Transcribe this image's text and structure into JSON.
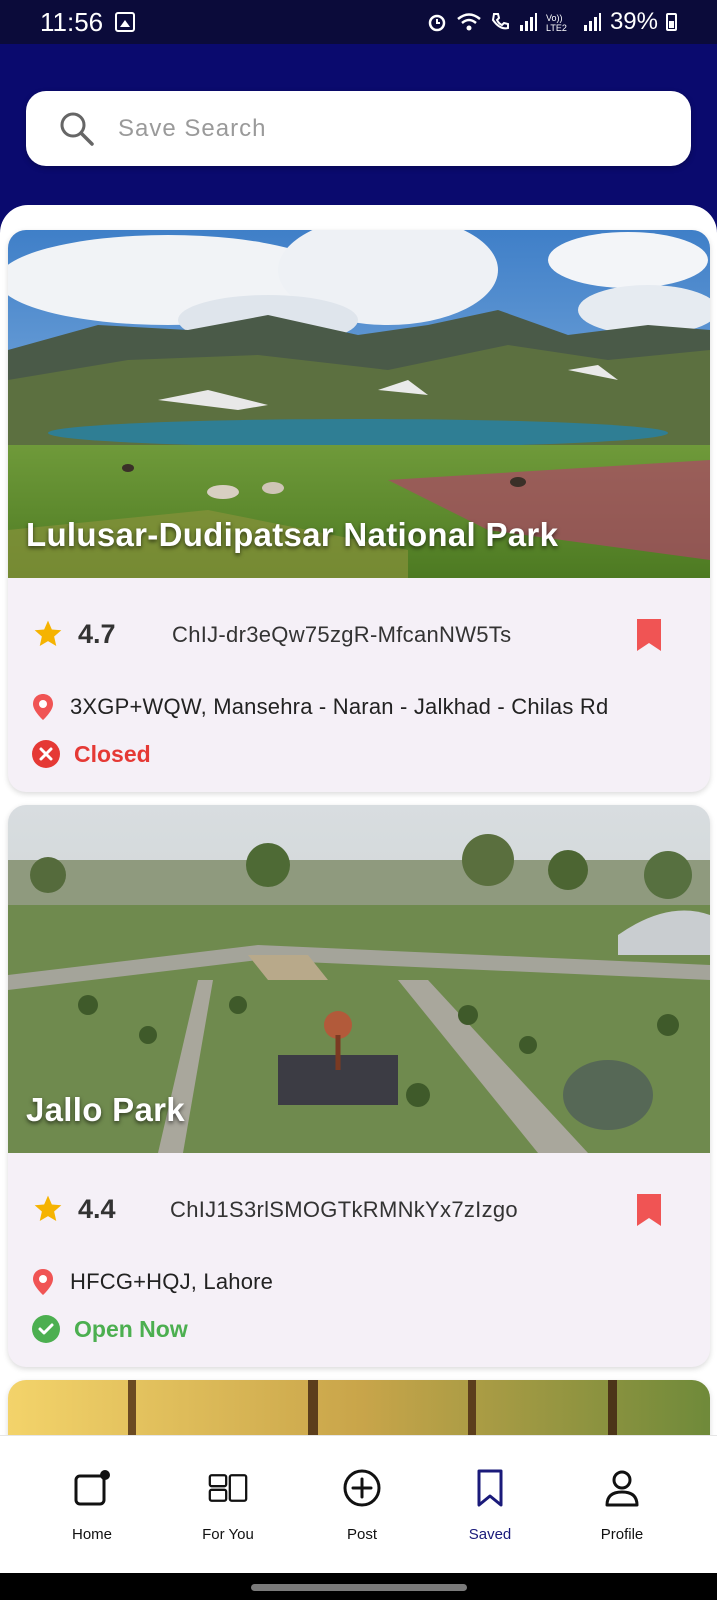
{
  "status_bar": {
    "time": "11:56",
    "battery": "39%"
  },
  "search": {
    "placeholder": "Save Search"
  },
  "cards": [
    {
      "title": "Lulusar-Dudipatsar National Park",
      "rating": "4.7",
      "place_id": "ChIJ-dr3eQw75zgR-MfcanNW5Ts",
      "address": "3XGP+WQW, Mansehra - Naran - Jalkhad - Chilas Rd",
      "status": "Closed",
      "status_color": "#e53935"
    },
    {
      "title": "Jallo Park",
      "rating": "4.4",
      "place_id": "ChIJ1S3rlSMOGTkRMNkYx7zIzgo",
      "address": "HFCG+HQJ, Lahore",
      "status": "Open Now",
      "status_color": "#4caf50"
    }
  ],
  "nav": {
    "home": "Home",
    "for_you": "For You",
    "post": "Post",
    "saved": "Saved",
    "profile": "Profile"
  },
  "colors": {
    "header_bg": "#0a0a6e",
    "bookmark": "#f05454",
    "star": "#f5b301",
    "active_nav": "#1a1a7a"
  }
}
